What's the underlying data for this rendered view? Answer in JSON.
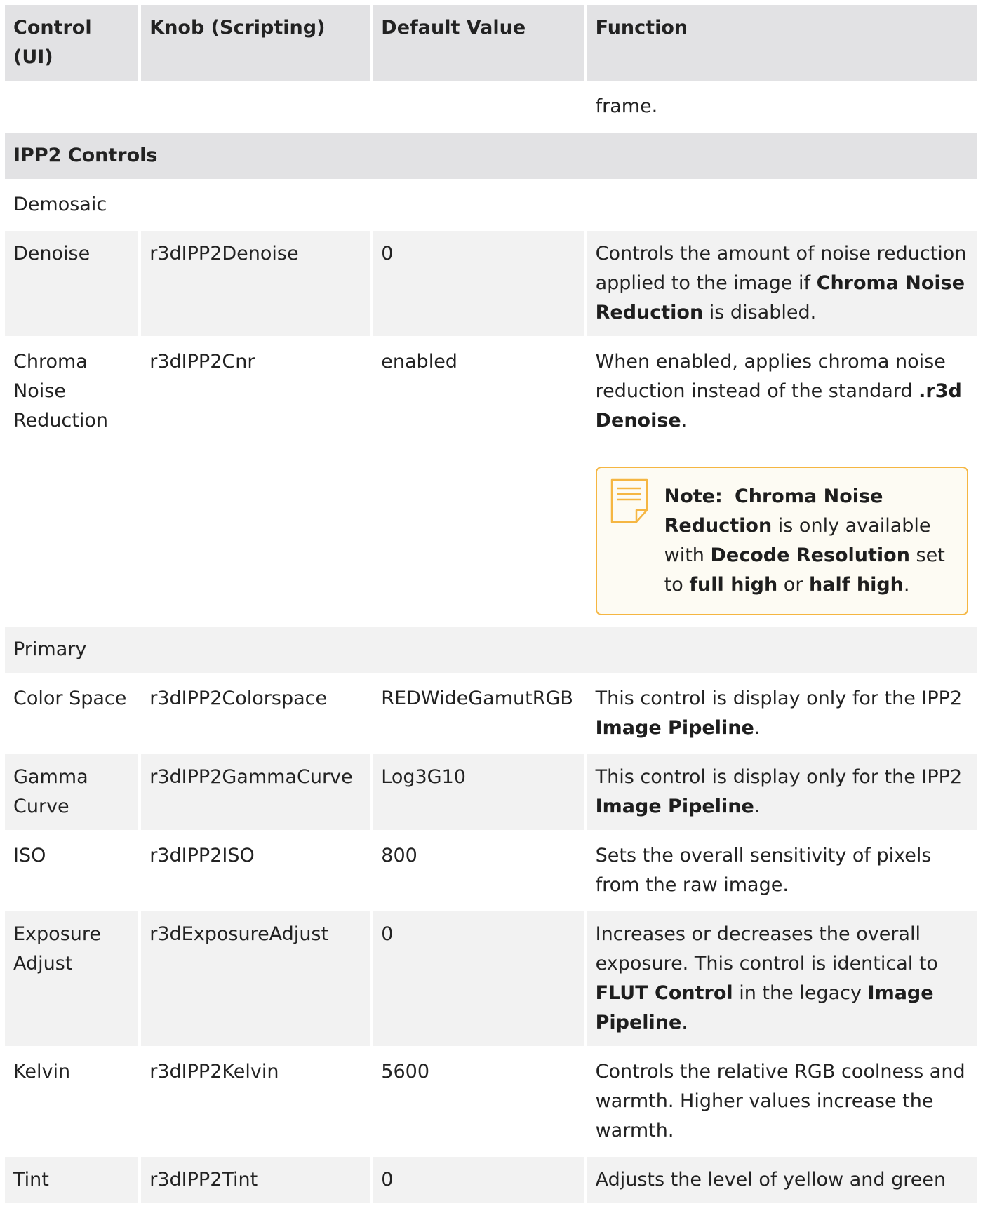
{
  "header": {
    "col1": "Control (UI)",
    "col2": "Knob (Scripting)",
    "col3": "Default Value",
    "col4": "Function"
  },
  "continued": {
    "function": "frame."
  },
  "section": {
    "title": "IPP2 Controls"
  },
  "groups": {
    "demosaic": "Demosaic",
    "primary": "Primary"
  },
  "rows": {
    "denoise": {
      "control": "Denoise",
      "knob": "r3dIPP2Denoise",
      "default": "0",
      "f1": "Controls the amount of noise reduction applied to the image if ",
      "f2": "Chroma Noise Reduction",
      "f3": " is disabled."
    },
    "cnr": {
      "control": "Chroma Noise Reduction",
      "knob": "r3dIPP2Cnr",
      "default": "enabled",
      "f1": "When enabled, applies chroma noise reduction instead of the standard ",
      "f2": ".r3d Denoise",
      "f3": ".",
      "note": {
        "label": "Note:",
        "n1": "Chroma Noise Reduction",
        "n2": " is only available with ",
        "n3": "Decode Resolution",
        "n4": " set to ",
        "n5": "full high",
        "n6": " or ",
        "n7": "half high",
        "n8": "."
      }
    },
    "colorspace": {
      "control": "Color Space",
      "knob": "r3dIPP2Colorspace",
      "default": "REDWideGamutRGB",
      "f1": "This control is display only for the IPP2 ",
      "f2": "Image Pipeline",
      "f3": "."
    },
    "gamma": {
      "control": "Gamma Curve",
      "knob": "r3dIPP2GammaCurve",
      "default": "Log3G10",
      "f1": "This control is display only for the IPP2 ",
      "f2": "Image Pipeline",
      "f3": "."
    },
    "iso": {
      "control": "ISO",
      "knob": "r3dIPP2ISO",
      "default": "800",
      "f1": "Sets the overall sensitivity of pixels from the raw image."
    },
    "exposure": {
      "control": "Exposure Adjust",
      "knob": "r3dExposureAdjust",
      "default": "0",
      "f1": "Increases or decreases the overall exposure. This control is identical to ",
      "f2": "FLUT Control",
      "f3": " in the legacy ",
      "f4": "Image Pipeline",
      "f5": "."
    },
    "kelvin": {
      "control": "Kelvin",
      "knob": "r3dIPP2Kelvin",
      "default": "5600",
      "f1": "Controls the relative RGB coolness and warmth. Higher values increase the warmth."
    },
    "tint": {
      "control": "Tint",
      "knob": "r3dIPP2Tint",
      "default": "0",
      "f1": "Adjusts the level of yellow and green"
    }
  },
  "colors": {
    "header_bg": "#e2e2e4",
    "row_alt_bg": "#f2f2f2",
    "note_border": "#f5b642",
    "note_icon": "#f5b642"
  }
}
